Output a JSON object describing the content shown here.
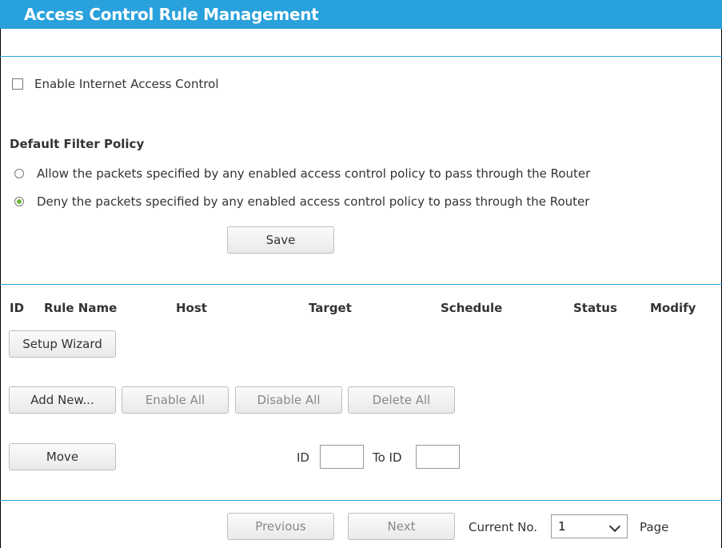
{
  "header": {
    "title": "Access Control Rule Management"
  },
  "enable_control": {
    "label": "Enable Internet Access Control",
    "checked": false
  },
  "policy": {
    "heading": "Default Filter Policy",
    "options": [
      {
        "label": "Allow the packets specified by any enabled access control policy to pass through the Router",
        "selected": false
      },
      {
        "label": "Deny the packets specified by any enabled access control policy to pass through the Router",
        "selected": true
      }
    ],
    "save_label": "Save"
  },
  "table": {
    "columns": [
      "ID",
      "Rule Name",
      "Host",
      "Target",
      "Schedule",
      "Status",
      "Modify"
    ],
    "setup_wizard_label": "Setup Wizard"
  },
  "actions": {
    "add_new": "Add New...",
    "enable_all": "Enable All",
    "disable_all": "Disable All",
    "delete_all": "Delete All"
  },
  "move": {
    "button_label": "Move",
    "id_label": "ID",
    "to_id_label": "To ID",
    "id_value": "",
    "to_id_value": ""
  },
  "pagination": {
    "previous": "Previous",
    "next": "Next",
    "current_label": "Current No.",
    "current_value": "1",
    "page_label": "Page"
  },
  "colors": {
    "accent": "#29a1dc",
    "radio_selected": "#6bb63a"
  }
}
